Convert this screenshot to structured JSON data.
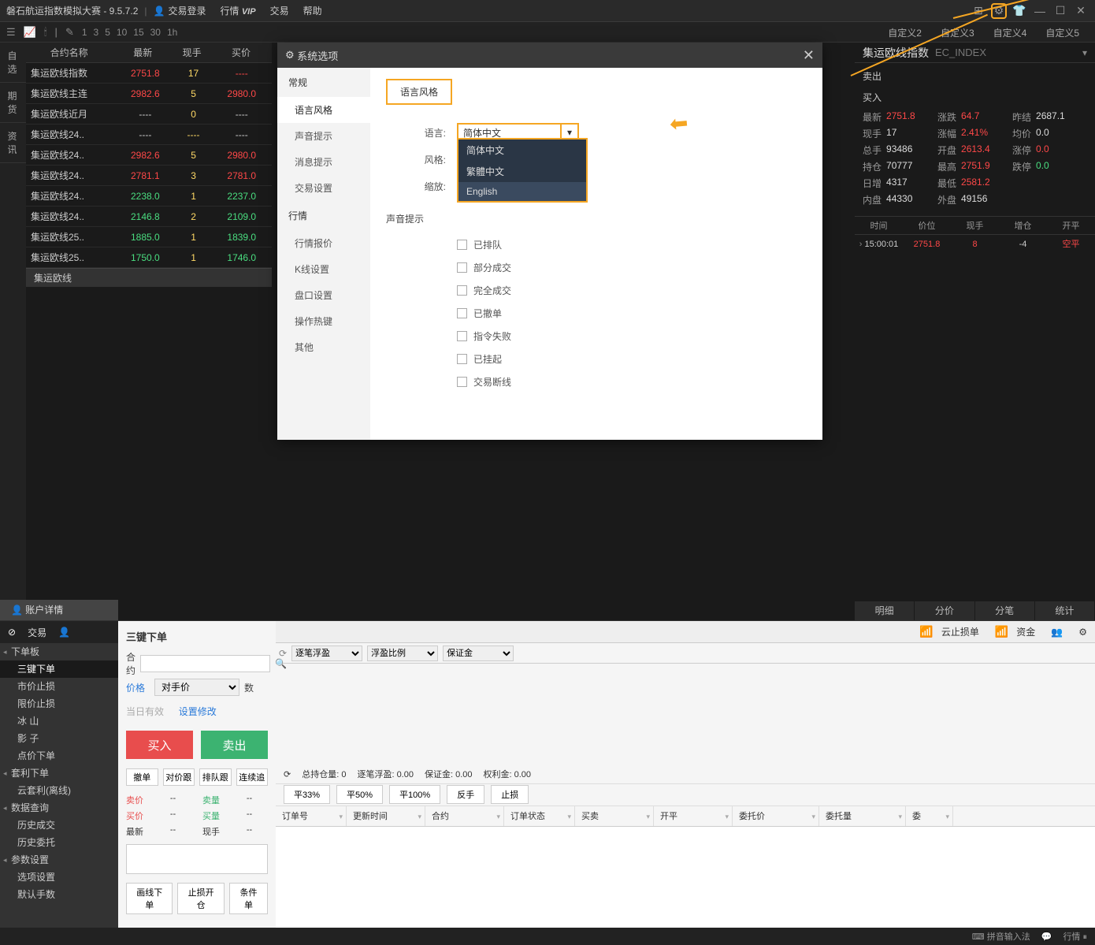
{
  "titlebar": {
    "app": "磐石航运指数模拟大赛 - 9.5.7.2",
    "login": "交易登录",
    "menus": {
      "quote": "行情",
      "vip": "VIP",
      "trade": "交易",
      "help": "帮助"
    }
  },
  "toolbar": {
    "times": [
      "1",
      "3",
      "5",
      "10",
      "15",
      "30",
      "1h"
    ],
    "tabs": [
      "自定义2",
      "自定义3",
      "自定义4",
      "自定义5"
    ]
  },
  "quote": {
    "head": [
      "合约名称",
      "最新",
      "现手",
      "买价"
    ],
    "rows": [
      {
        "name": "集运欧线指数",
        "latest": "2751.8",
        "vol": "17",
        "bid": "----",
        "cls": "red"
      },
      {
        "name": "集运欧线主连",
        "latest": "2982.6",
        "vol": "5",
        "bid": "2980.0",
        "cls": "red"
      },
      {
        "name": "集运欧线近月",
        "latest": "----",
        "vol": "0",
        "bid": "----",
        "cls": "gray"
      },
      {
        "name": "集运欧线24..",
        "latest": "----",
        "vol": "----",
        "bid": "----",
        "cls": "gray"
      },
      {
        "name": "集运欧线24..",
        "latest": "2982.6",
        "vol": "5",
        "bid": "2980.0",
        "cls": "red"
      },
      {
        "name": "集运欧线24..",
        "latest": "2781.1",
        "vol": "3",
        "bid": "2781.0",
        "cls": "red"
      },
      {
        "name": "集运欧线24..",
        "latest": "2238.0",
        "vol": "1",
        "bid": "2237.0",
        "cls": "green"
      },
      {
        "name": "集运欧线24..",
        "latest": "2146.8",
        "vol": "2",
        "bid": "2109.0",
        "cls": "green"
      },
      {
        "name": "集运欧线25..",
        "latest": "1885.0",
        "vol": "1",
        "bid": "1839.0",
        "cls": "green"
      },
      {
        "name": "集运欧线25..",
        "latest": "1750.0",
        "vol": "1",
        "bid": "1746.0",
        "cls": "green"
      }
    ],
    "bottom_tab": "集运欧线"
  },
  "detail": {
    "name": "集运欧线指数",
    "code": "EC_INDEX",
    "sell": "卖出",
    "buy": "买入",
    "rows": [
      [
        [
          "最新",
          "2751.8",
          "red"
        ],
        [
          "涨跌",
          "64.7",
          "red"
        ],
        [
          "昨结",
          "2687.1",
          ""
        ]
      ],
      [
        [
          "现手",
          "17",
          ""
        ],
        [
          "涨幅",
          "2.41%",
          "red"
        ],
        [
          "均价",
          "0.0",
          ""
        ]
      ],
      [
        [
          "总手",
          "93486",
          ""
        ],
        [
          "开盘",
          "2613.4",
          "red"
        ],
        [
          "涨停",
          "0.0",
          "red"
        ]
      ],
      [
        [
          "持仓",
          "70777",
          ""
        ],
        [
          "最高",
          "2751.9",
          "red"
        ],
        [
          "跌停",
          "0.0",
          "green"
        ]
      ],
      [
        [
          "日增",
          "4317",
          ""
        ],
        [
          "最低",
          "2581.2",
          "red"
        ],
        [
          "",
          ""
        ]
      ],
      [
        [
          "内盘",
          "44330",
          ""
        ],
        [
          "外盘",
          "49156",
          ""
        ],
        [
          "",
          ""
        ]
      ]
    ],
    "tick_head": [
      "时间",
      "价位",
      "现手",
      "增仓",
      "开平"
    ],
    "tick": [
      "15:00:01",
      "2751.8",
      "8",
      "-4",
      "空平"
    ],
    "tabs": [
      "明细",
      "分价",
      "分笔",
      "统计"
    ]
  },
  "rail": {
    "a": "自选",
    "b": "期货",
    "c": "资讯"
  },
  "trade_nav": {
    "title": "交易",
    "items": [
      "下单板",
      "三键下单",
      "市价止损",
      "限价止损",
      "冰 山",
      "影 子",
      "点价下单",
      "套利下单",
      "云套利(离线)",
      "数据查询",
      "历史成交",
      "历史委托",
      "参数设置",
      "选项设置",
      "默认手数"
    ],
    "active": 1,
    "headers": [
      0,
      7,
      9,
      12
    ],
    "acct": "账户详情"
  },
  "order_panel": {
    "title": "三键下单",
    "contract_lbl": "合约",
    "price_lbl": "价格",
    "price_opt": "对手价",
    "qty_lbl": "数",
    "today": "当日有效",
    "modify": "设置修改",
    "buy": "买入",
    "sell": "卖出",
    "small": [
      "撤单",
      "对价跟",
      "排队跟",
      "连续追"
    ],
    "mini": {
      "sp": "卖价",
      "sv": "卖量",
      "bp": "买价",
      "bv": "买量",
      "la": "最新",
      "vo": "现手",
      "dash": "--"
    },
    "bot": [
      "画线下单",
      "止损开仓",
      "条件单"
    ]
  },
  "orders": {
    "top": {
      "stop": "云止损单",
      "fund": "资金"
    },
    "filter": [
      "逐笔浮盈",
      "浮盈比例",
      "保证金"
    ],
    "summary": {
      "pos": "总持仓量: 0",
      "pnl": "逐笔浮盈: 0.00",
      "margin": "保证金: 0.00",
      "equity": "权利金: 0.00"
    },
    "btns": [
      "平33%",
      "平50%",
      "平100%",
      "反手",
      "止损"
    ],
    "grid": [
      "订单号",
      "更新时间",
      "合约",
      "订单状态",
      "买卖",
      "开平",
      "委托价",
      "委托量",
      "委"
    ]
  },
  "dialog": {
    "title": "系统选项",
    "side": {
      "cat1": "常规",
      "subs1": [
        "语言风格",
        "声音提示",
        "消息提示",
        "交易设置"
      ],
      "cat2": "行情",
      "subs2": [
        "行情报价",
        "K线设置",
        "盘口设置",
        "操作热键",
        "其他"
      ]
    },
    "tab": "语言风格",
    "lang_lbl": "语言:",
    "style_lbl": "风格:",
    "zoom_lbl": "缩放:",
    "lang_sel": "简体中文",
    "opts": [
      "简体中文",
      "繁體中文",
      "English"
    ],
    "sound_title": "声音提示",
    "checks": [
      "已排队",
      "部分成交",
      "完全成交",
      "已撤单",
      "指令失败",
      "已挂起",
      "交易断线"
    ]
  },
  "status": {
    "input": "拼音输入法",
    "quote": "行情"
  }
}
